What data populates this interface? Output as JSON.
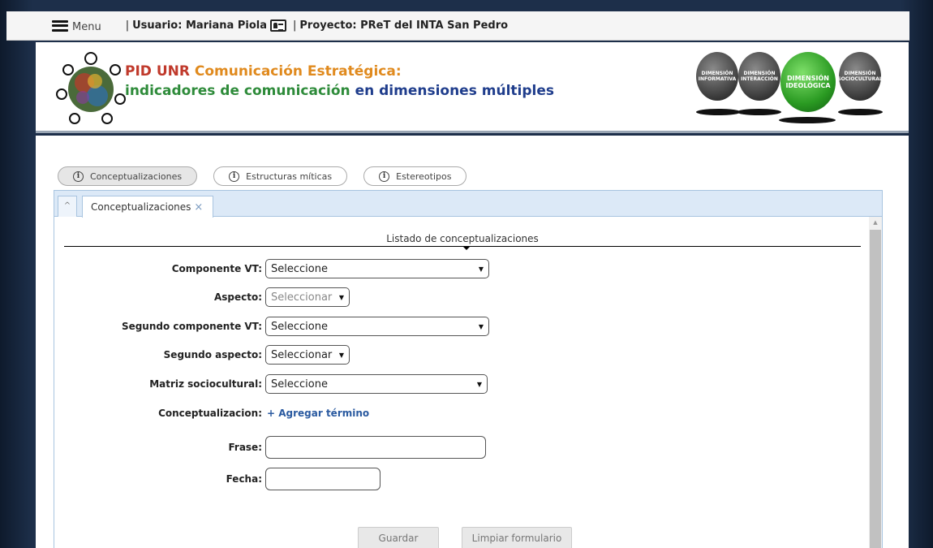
{
  "topbar": {
    "menu_label": "Menu",
    "user_prefix": "Usuario: Mariana Piola",
    "project_text": "Proyecto: PReT del INTA San Pedro"
  },
  "header": {
    "title_pid": "PID UNR",
    "title_ce": "Comunicación Estratégica:",
    "title_a": "indicadores de comunicación",
    "title_b": "en dimensiones múltiples",
    "dimensions": [
      {
        "label": "DIMENSIÓN INFORMATIVA",
        "active": false
      },
      {
        "label": "DIMENSIÓN INTERACCIÓN",
        "active": false
      },
      {
        "label": "DIMENSIÓN IDEOLÓGICA",
        "active": true
      },
      {
        "label": "DIMENSIÓN SOCIOCULTURAL",
        "active": false
      }
    ]
  },
  "pill_tabs": [
    {
      "label": "Conceptualizaciones",
      "active": true
    },
    {
      "label": "Estructuras míticas",
      "active": false
    },
    {
      "label": "Estereotipos",
      "active": false
    }
  ],
  "tabpanel": {
    "collapse_icon": "^",
    "tab_label": "Conceptualizaciones",
    "tab_close": "×",
    "list_title": "Listado de conceptualizaciones"
  },
  "form": {
    "componente_vt": {
      "label": "Componente VT:",
      "value": "Seleccione"
    },
    "aspecto": {
      "label": "Aspecto:",
      "value": "Seleccionar"
    },
    "segundo_componente": {
      "label": "Segundo componente VT:",
      "value": "Seleccione"
    },
    "segundo_aspecto": {
      "label": "Segundo aspecto:",
      "value": "Seleccionar"
    },
    "matriz": {
      "label": "Matriz sociocultural:",
      "value": "Seleccione"
    },
    "conceptualizacion": {
      "label": "Conceptualizacion:",
      "link": "+ Agregar término"
    },
    "frase": {
      "label": "Frase:",
      "value": ""
    },
    "fecha": {
      "label": "Fecha:",
      "value": ""
    },
    "save_label": "Guardar",
    "clear_label": "Limpiar formulario"
  },
  "colors": {
    "accent_red": "#c0392b",
    "accent_orange": "#e08a1e",
    "accent_green": "#2e8b3a",
    "accent_blue": "#1f3d8c",
    "link_blue": "#2a5aa0"
  }
}
